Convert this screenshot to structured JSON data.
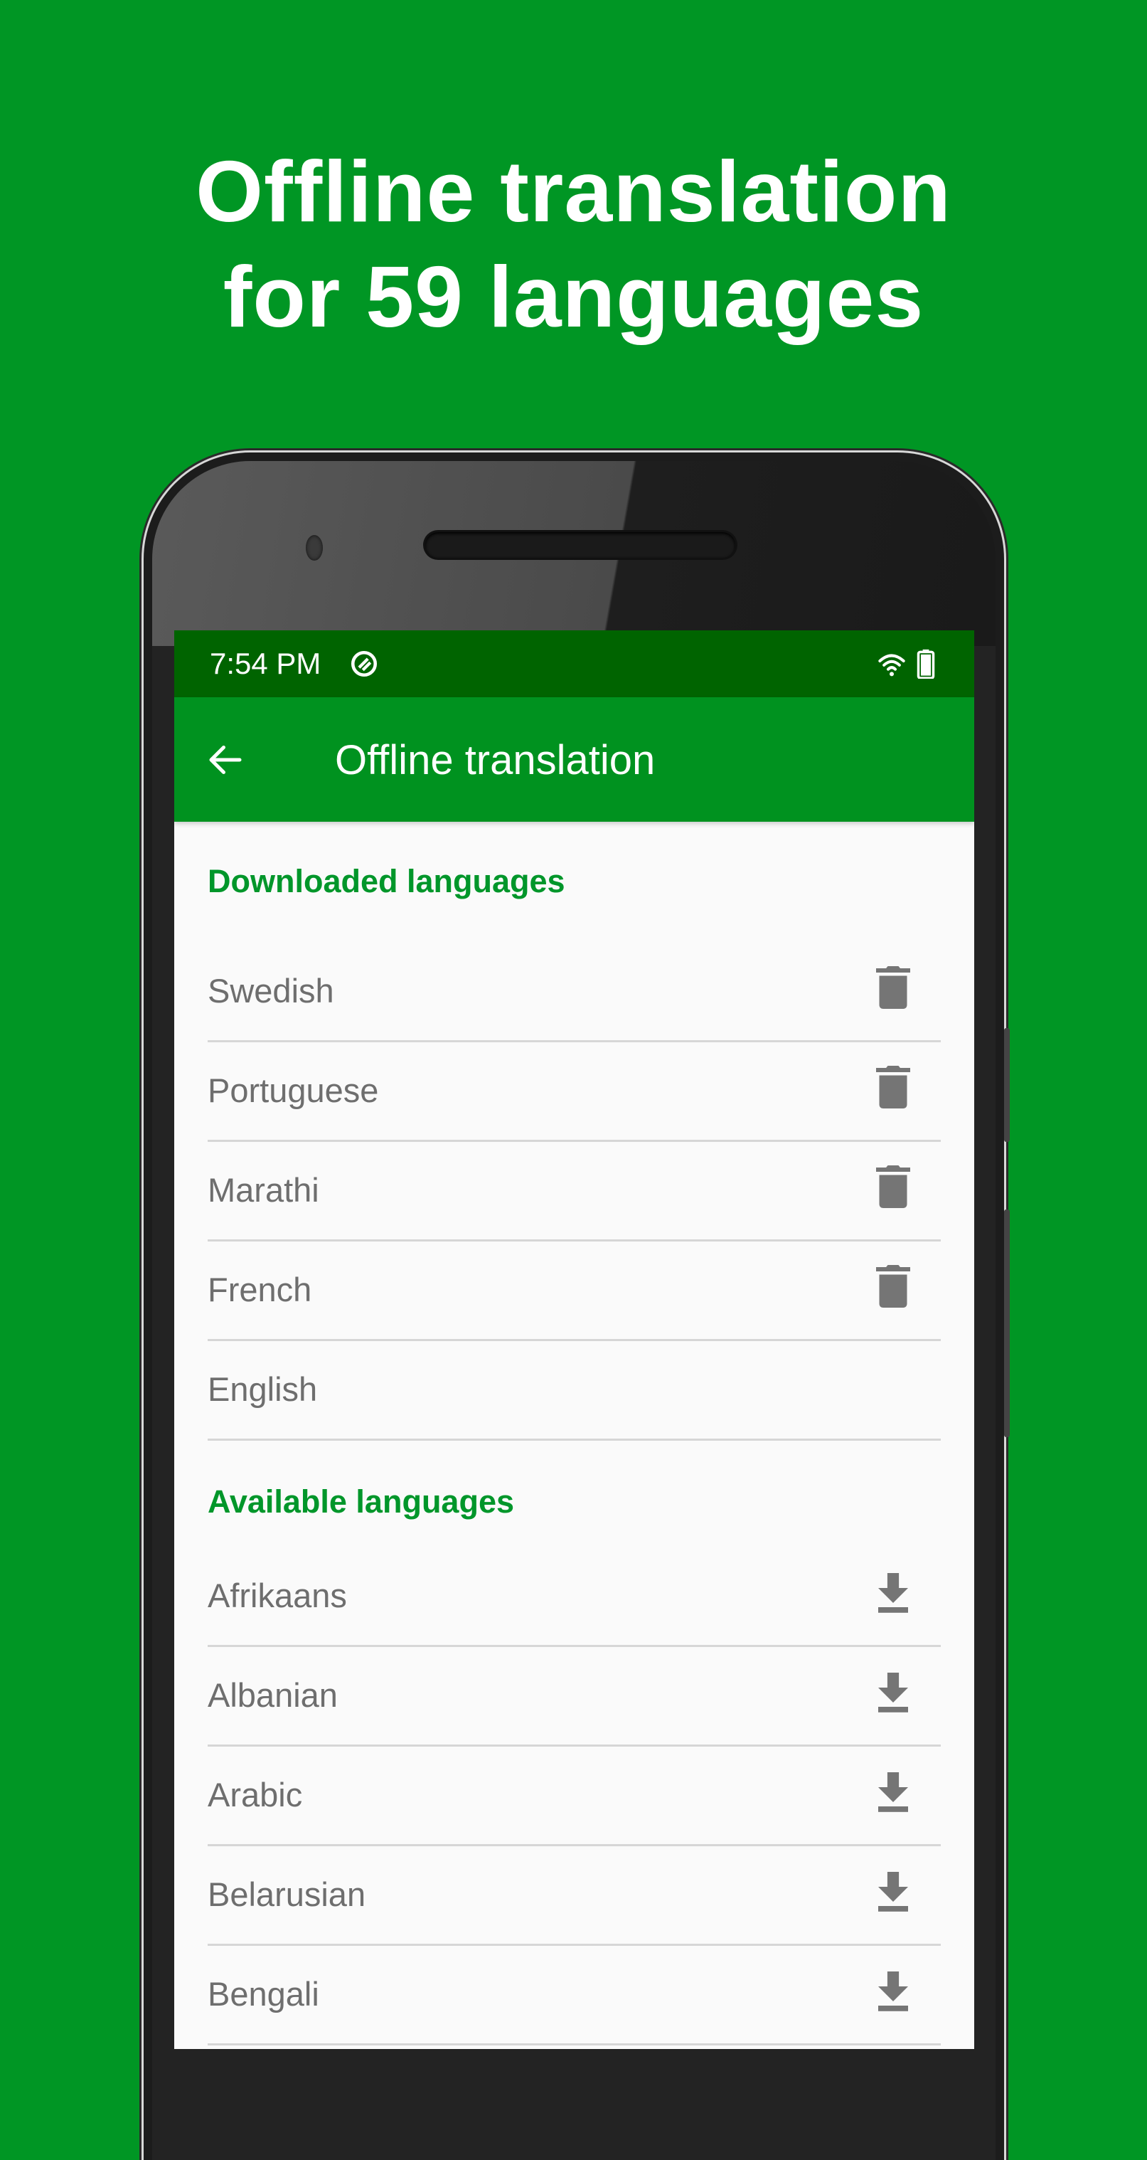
{
  "headline": {
    "line1": "Offline translation",
    "line2": "for 59 languages"
  },
  "colors": {
    "background": "#009624",
    "status_bar": "#006400",
    "app_bar": "#00921f",
    "accent": "#00962a",
    "list_bg": "#fafafa",
    "row_text": "#6e6e6e",
    "icon": "#757575"
  },
  "status_bar": {
    "time": "7:54 PM",
    "icons": [
      "vpn-icon",
      "wifi-icon",
      "battery-icon"
    ]
  },
  "app_bar": {
    "back_icon": "arrow-left-icon",
    "title": "Offline translation"
  },
  "sections": {
    "downloaded": {
      "title": "Downloaded languages",
      "items": [
        {
          "label": "Swedish",
          "action": "delete-icon"
        },
        {
          "label": "Portuguese",
          "action": "delete-icon"
        },
        {
          "label": "Marathi",
          "action": "delete-icon"
        },
        {
          "label": "French",
          "action": "delete-icon"
        },
        {
          "label": "English",
          "action": ""
        }
      ]
    },
    "available": {
      "title": "Available languages",
      "items": [
        {
          "label": "Afrikaans",
          "action": "download-icon"
        },
        {
          "label": "Albanian",
          "action": "download-icon"
        },
        {
          "label": "Arabic",
          "action": "download-icon"
        },
        {
          "label": "Belarusian",
          "action": "download-icon"
        },
        {
          "label": "Bengali",
          "action": "download-icon"
        }
      ]
    }
  }
}
